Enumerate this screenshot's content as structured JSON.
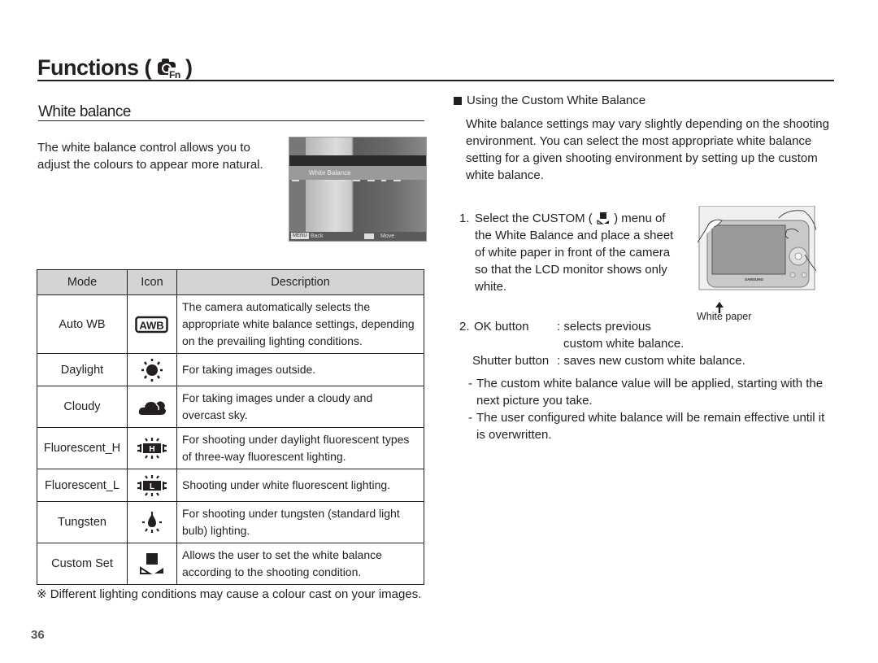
{
  "header": {
    "title": "Functions (",
    "title_close": ")",
    "icon": "camera-fn-icon"
  },
  "section": {
    "title": "White balance",
    "intro": "The white balance control allows you to adjust the colours to appear more natural."
  },
  "lcd": {
    "menu_label": "White Balance",
    "back_key": "MENU",
    "back_label": "Back",
    "move_label": "Move"
  },
  "table": {
    "headers": [
      "Mode",
      "Icon",
      "Description"
    ],
    "rows": [
      {
        "mode": "Auto WB",
        "icon": "awb-icon",
        "icon_text": "AWB",
        "description": "The camera automatically selects the appropriate white balance settings, depending on the prevailing lighting conditions."
      },
      {
        "mode": "Daylight",
        "icon": "daylight-icon",
        "description": "For taking images outside."
      },
      {
        "mode": "Cloudy",
        "icon": "cloudy-icon",
        "description": "For taking images under a cloudy and overcast sky."
      },
      {
        "mode": "Fluorescent_H",
        "icon": "fluorescent-h-icon",
        "icon_text": "H",
        "description": "For shooting under daylight fluorescent types of three-way fluorescent lighting."
      },
      {
        "mode": "Fluorescent_L",
        "icon": "fluorescent-l-icon",
        "icon_text": "L",
        "description": "Shooting under white fluorescent lighting."
      },
      {
        "mode": "Tungsten",
        "icon": "tungsten-icon",
        "description": "For shooting under tungsten (standard light bulb) lighting."
      },
      {
        "mode": "Custom Set",
        "icon": "custom-set-icon",
        "description": "Allows the user to set the white balance according to the shooting condition."
      }
    ]
  },
  "footnote": "※ Different lighting conditions may cause a colour cast on your images.",
  "custom": {
    "heading": "Using the Custom White Balance",
    "body": "White balance settings may vary slightly depending on the shooting environment. You can select the most appropriate white balance setting for a given shooting environment by setting up the custom white balance.",
    "step1_num": "1.",
    "step1_pre": "Select the CUSTOM (",
    "step1_post": ") menu of the White Balance and place a sheet of white paper in front of the camera so that the LCD monitor shows only white.",
    "figure_caption": "White paper",
    "camera_brand": "SAMSUNG",
    "step2_num": "2.",
    "step2_ok_label": "OK button",
    "step2_ok_desc": ": selects previous",
    "step2_ok_desc2": "custom white balance.",
    "step2_shutter_label": "Shutter button",
    "step2_shutter_desc": ": saves new custom white balance.",
    "bullets": [
      "The custom white balance value will be applied, starting with the next picture you take.",
      "The user configured white balance will be remain effective until it is overwritten."
    ]
  },
  "page_number": "36"
}
